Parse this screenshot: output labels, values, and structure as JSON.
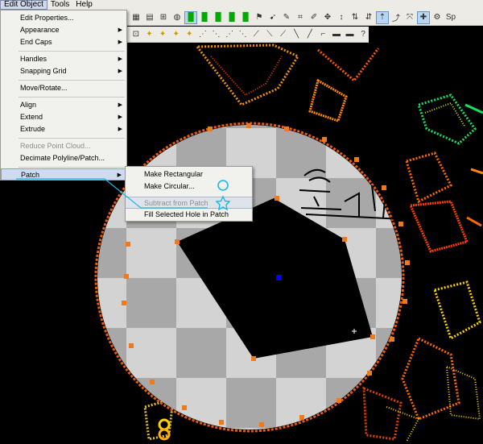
{
  "menubar": {
    "items": [
      "Edit Object",
      "Tools",
      "Help"
    ]
  },
  "menu": {
    "items": [
      {
        "label": "Edit Properties...",
        "arrow": ""
      },
      {
        "label": "Appearance",
        "arrow": "▶"
      },
      {
        "label": "End Caps",
        "arrow": "▶"
      },
      {
        "label": "Handles",
        "arrow": "▶"
      },
      {
        "label": "Snapping Grid",
        "arrow": "▶"
      },
      {
        "label": "Move/Rotate...",
        "arrow": ""
      },
      {
        "label": "Align",
        "arrow": "▶"
      },
      {
        "label": "Extend",
        "arrow": "▶"
      },
      {
        "label": "Extrude",
        "arrow": "▶"
      },
      {
        "label": "Reduce Point Cloud...",
        "arrow": ""
      },
      {
        "label": "Decimate Polyline/Patch...",
        "arrow": ""
      },
      {
        "label": "Patch",
        "arrow": "▶"
      }
    ]
  },
  "submenu": {
    "items": [
      {
        "label": "Make Rectangular"
      },
      {
        "label": "Make Circular..."
      },
      {
        "label": "Subtract from Patch"
      },
      {
        "label": "Fill Selected Hole in Patch"
      }
    ]
  },
  "toolbar": {
    "top_partial_label": "Sp"
  },
  "colors": {
    "menu_bg": "#f1f1ee",
    "selection": "#cfdcee",
    "checker_light": "#d3d3d3",
    "checker_dark": "#a8a8a8",
    "handle": "#f07a1a",
    "center_handle": "#0000ff",
    "annotation_ink": "#1bb7ea"
  }
}
